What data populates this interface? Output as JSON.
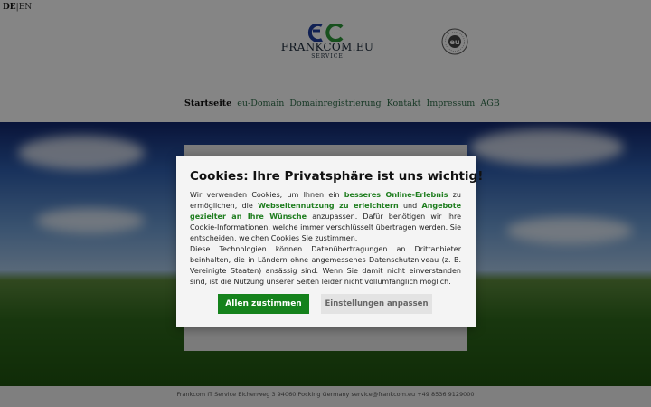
{
  "header": {
    "lang_de": "DE",
    "lang_sep": "|",
    "lang_en": "EN",
    "brand_name": "FRANKCOM.EU",
    "brand_sub": "SERVICE",
    "brand_mark": "FC",
    "seal_text": "eu"
  },
  "nav": {
    "items": [
      "Startseite",
      "eu-Domain",
      "Domainregistrierung",
      "Kontakt",
      "Impressum",
      "AGB"
    ]
  },
  "footer": {
    "text": "Frankcom IT Service Eichenweg 3 94060 Pocking Germany service@frankcom.eu +49 8536 9129000"
  },
  "cookie_dialog": {
    "title": "Cookies: Ihre Privatsphäre ist uns wichtig!",
    "t1": "Wir verwenden Cookies, um Ihnen ein ",
    "h1": "besseres Online-Erlebnis",
    "t2": " zu ermöglichen, die ",
    "h2": "Webseitennutzung zu erleichtern",
    "t3": " und ",
    "h3": "Angebote gezielter an Ihre Wünsche",
    "t4": " anzupassen. Dafür benötigen wir Ihre Cookie-Informationen, welche immer verschlüsselt übertragen werden. Sie entscheiden, welchen Cookies Sie zustimmen.",
    "t5": "Diese Technologien können Datenübertragungen an Drittanbieter beinhalten, die in Ländern ohne angemessenes Datenschutzniveau (z. B. Vereinigte Staaten) ansässig sind. Wenn Sie damit nicht einverstanden sind, ist die Nutzung unserer Seiten leider nicht vollumfänglich möglich.",
    "accept_label": "Allen zustimmen",
    "settings_label": "Einstellungen anpassen"
  },
  "colors": {
    "accept": "#15821c",
    "highlight": "#1e7d1e",
    "dialog_bg": "#f4f4f4"
  }
}
